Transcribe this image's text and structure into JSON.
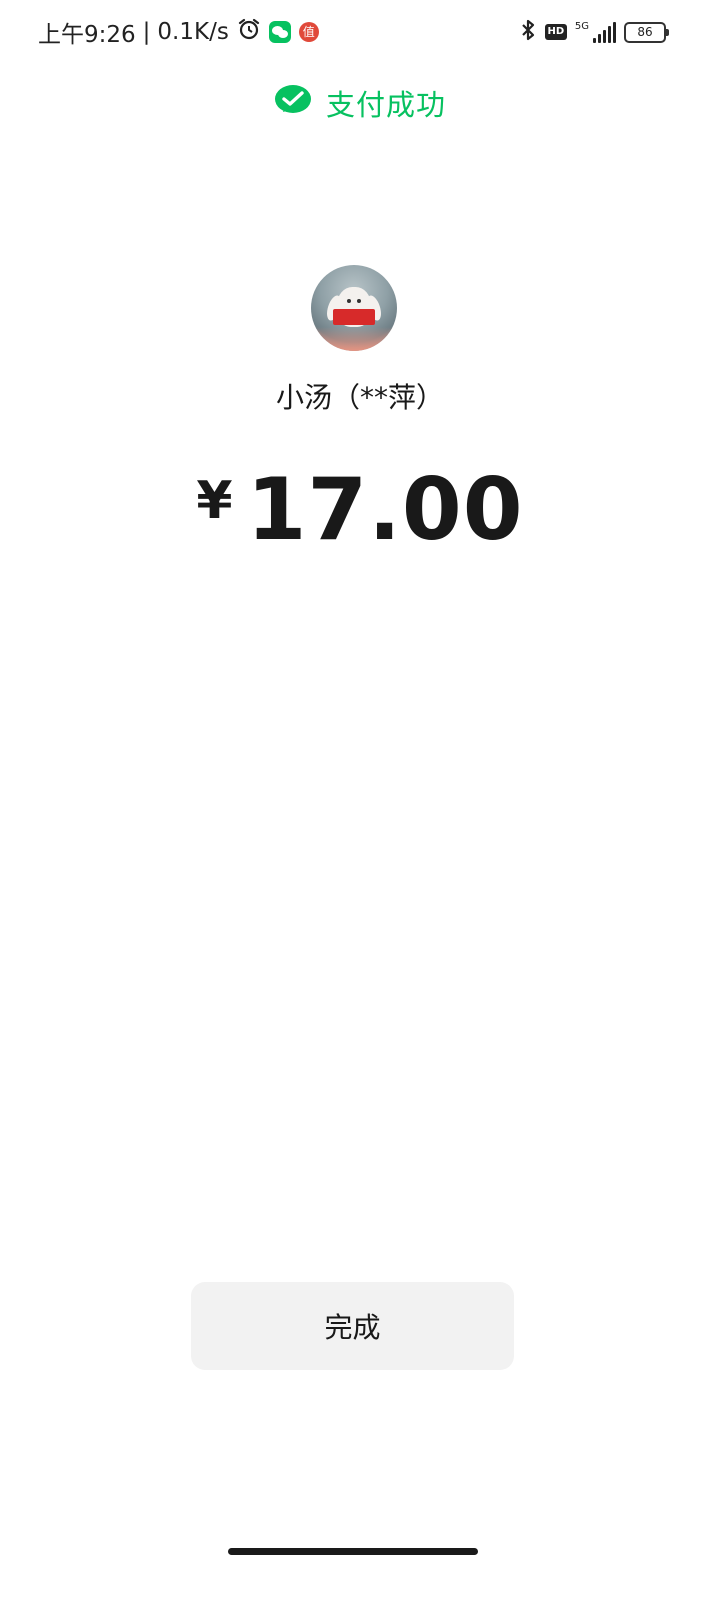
{
  "status_bar": {
    "time": "上午9:26",
    "separator": "|",
    "network_speed": "0.1K/s",
    "left_icons": [
      "alarm-icon",
      "wechat-icon",
      "app-badge-icon"
    ],
    "app_badge_char": "值",
    "right_icons": [
      "bluetooth-icon",
      "hd-icon",
      "5g-signal-icon",
      "battery-icon"
    ],
    "hd_label": "HD",
    "network_type": "5G",
    "battery_level": "86"
  },
  "header": {
    "icon": "wechat-pay-check-icon",
    "title": "支付成功",
    "accent_color": "#07c160"
  },
  "payee": {
    "avatar": "bunny-avatar",
    "name": "小汤（**萍）"
  },
  "amount": {
    "currency_symbol": "¥",
    "value": "17.00"
  },
  "actions": {
    "done_label": "完成"
  }
}
